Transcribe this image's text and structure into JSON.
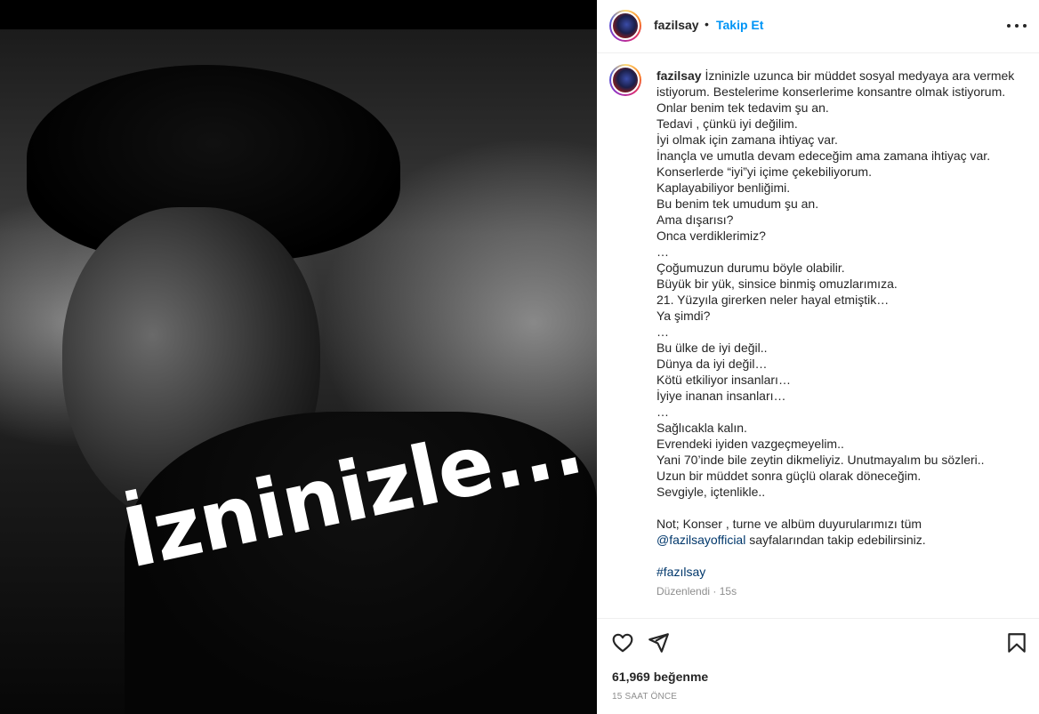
{
  "media": {
    "overlay_text": "İzninizle..."
  },
  "header": {
    "username": "fazilsay",
    "separator": "•",
    "follow_label": "Takip Et"
  },
  "caption": {
    "username": "fazilsay",
    "first_line": " İzninizle uzunca bir müddet sosyal medyaya ara vermek istiyorum. Bestelerime konserlerime konsantre olmak istiyorum. Onlar benim tek tedavim şu an.",
    "lines": [
      "Tedavi , çünkü iyi değilim.",
      "İyi olmak için zamana ihtiyaç var.",
      "İnançla ve umutla devam edeceğim ama zamana ihtiyaç var.",
      "Konserlerde “iyi”yi içime çekebiliyorum.",
      "Kaplayabiliyor benliğimi.",
      "Bu benim tek umudum şu an.",
      "Ama dışarısı?",
      "Onca verdiklerimiz?",
      "…",
      "Çoğumuzun durumu böyle olabilir.",
      "Büyük bir yük, sinsice binmiş omuzlarımıza.",
      "21. Yüzyıla girerken neler hayal etmiştik…",
      "Ya şimdi?",
      "…",
      "Bu ülke de iyi değil..",
      "Dünya da iyi değil…",
      "Kötü etkiliyor insanları…",
      "İyiye inanan insanları…",
      "…",
      "Sağlıcakla kalın.",
      "Evrendeki iyiden vazgeçmeyelim..",
      "Yani 70’inde bile zeytin dikmeliyiz. Unutmayalım bu sözleri..",
      "Uzun bir müddet sonra güçlü olarak döneceğim.",
      "Sevgiyle, içtenlikle.."
    ],
    "note_line": "Not; Konser , turne ve albüm duyurularımızı tüm",
    "mention": "@fazilsayofficial",
    "mention_suffix": " sayfalarından takip edebilirsiniz.",
    "hashtag": "#fazılsay",
    "edited_label": "Düzenlendi",
    "meta_separator": " · ",
    "age": "15s"
  },
  "actions": {
    "likes": "61,969 beğenme",
    "time_ago": "15 SAAT ÖNCE"
  },
  "icons": {
    "like": "heart-icon",
    "share": "paper-plane-icon",
    "save": "bookmark-icon",
    "more": "more-horizontal-icon"
  },
  "colors": {
    "accent": "#0095f6",
    "link": "#00376b",
    "muted": "#8e8e8e",
    "text": "#262626"
  }
}
